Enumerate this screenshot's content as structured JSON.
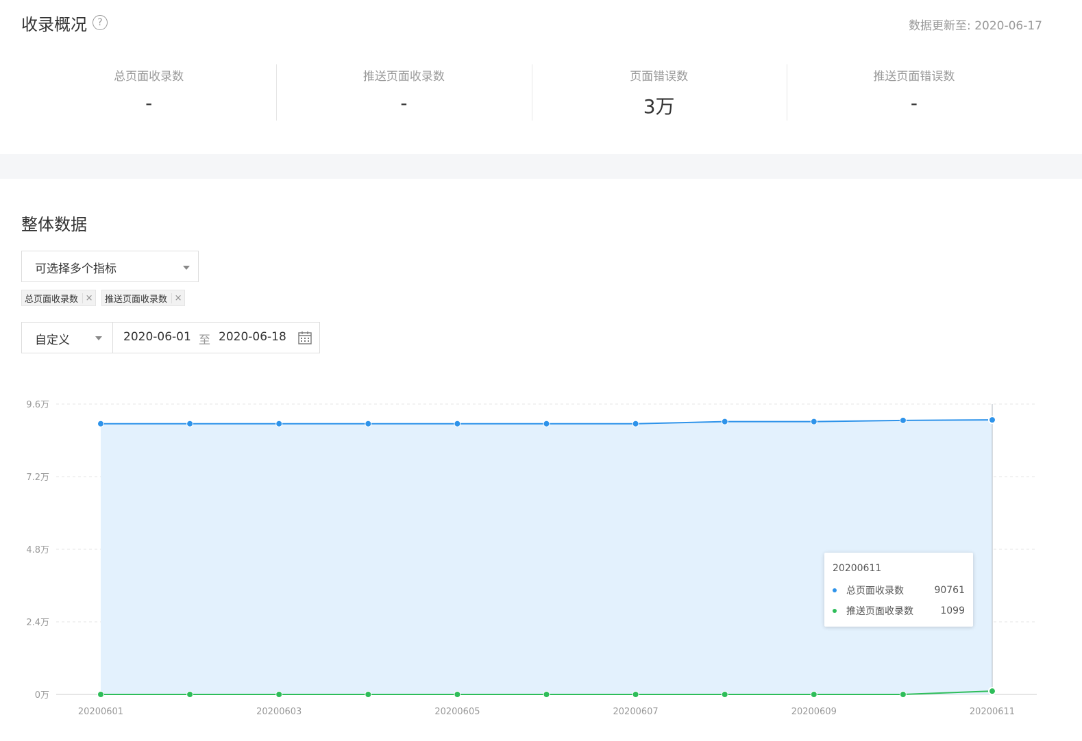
{
  "overview": {
    "title": "收录概况",
    "help_glyph": "?",
    "updated": "数据更新至: 2020-06-17",
    "stats": [
      {
        "label": "总页面收录数",
        "value": "-"
      },
      {
        "label": "推送页面收录数",
        "value": "-"
      },
      {
        "label": "页面错误数",
        "value": "3万"
      },
      {
        "label": "推送页面错误数",
        "value": "-"
      }
    ]
  },
  "section": {
    "title": "整体数据",
    "metric_placeholder": "可选择多个指标",
    "tags": [
      {
        "label": "总页面收录数",
        "remove": "×"
      },
      {
        "label": "推送页面收录数",
        "remove": "×"
      }
    ],
    "date_mode": "自定义",
    "date_from": "2020-06-01",
    "date_sep": "至",
    "date_to": "2020-06-18"
  },
  "colors": {
    "blue": "#2e93ea",
    "blue_fill": "#e3f1fd",
    "green": "#2ebd59"
  },
  "chart_data": {
    "type": "line",
    "x": [
      "20200601",
      "20200602",
      "20200603",
      "20200604",
      "20200605",
      "20200606",
      "20200607",
      "20200608",
      "20200609",
      "20200610",
      "20200611"
    ],
    "x_tick_labels": [
      "20200601",
      "20200603",
      "20200605",
      "20200607",
      "20200609",
      "20200611"
    ],
    "y_tick_labels": [
      "0万",
      "2.4万",
      "4.8万",
      "7.2万",
      "9.6万"
    ],
    "ylim": [
      0,
      96000
    ],
    "grid": true,
    "series": [
      {
        "name": "总页面收录数",
        "values": [
          89500,
          89500,
          89500,
          89500,
          89500,
          89500,
          89500,
          90200,
          90200,
          90600,
          90761
        ],
        "area": true
      },
      {
        "name": "推送页面收录数",
        "values": [
          0,
          0,
          0,
          0,
          0,
          0,
          0,
          0,
          0,
          0,
          1099
        ]
      }
    ],
    "tooltip": {
      "x": "20200611",
      "rows": [
        {
          "name": "总页面收录数",
          "value": "90761"
        },
        {
          "name": "推送页面收录数",
          "value": "1099"
        }
      ]
    }
  }
}
